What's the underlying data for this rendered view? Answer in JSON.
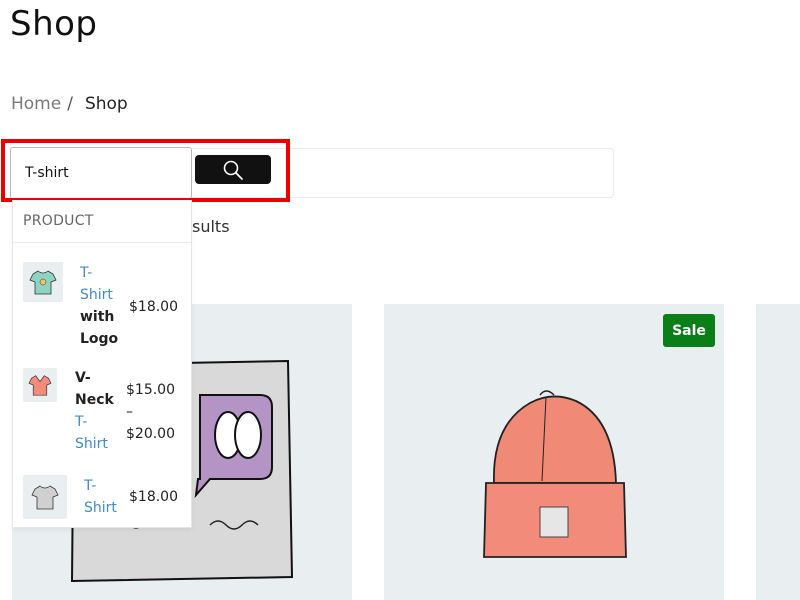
{
  "page": {
    "title": "Shop"
  },
  "breadcrumb": {
    "home": "Home",
    "separator": "/",
    "current": "Shop"
  },
  "search": {
    "value": "T-shirt",
    "button_icon": "search-icon"
  },
  "results": {
    "text_fragment": "sults"
  },
  "dropdown": {
    "header": "PRODUCT",
    "items": [
      {
        "name_link_1": "T-",
        "name_link_2": "Shirt",
        "name_bold_1": "with",
        "name_bold_2": "Logo",
        "price": "$18.00",
        "thumb_color": "#8fd3c3"
      },
      {
        "name_bold_1": "V-",
        "name_bold_2": "Neck",
        "name_link_1": "T-",
        "name_link_2": "Shirt",
        "price_low": "$15.00",
        "price_sep": "–",
        "price_high": "$20.00",
        "thumb_color": "#f28b7a"
      },
      {
        "name_link_1": "T-",
        "name_link_2": "Shirt",
        "price": "$18.00",
        "thumb_color": "#d0d0d0"
      }
    ]
  },
  "products": {
    "sale_badge": "Sale"
  },
  "colors": {
    "highlight": "#ee0000",
    "sale": "#0b7f17",
    "link": "#3d8ccc",
    "card_bg": "#e9eef1"
  }
}
